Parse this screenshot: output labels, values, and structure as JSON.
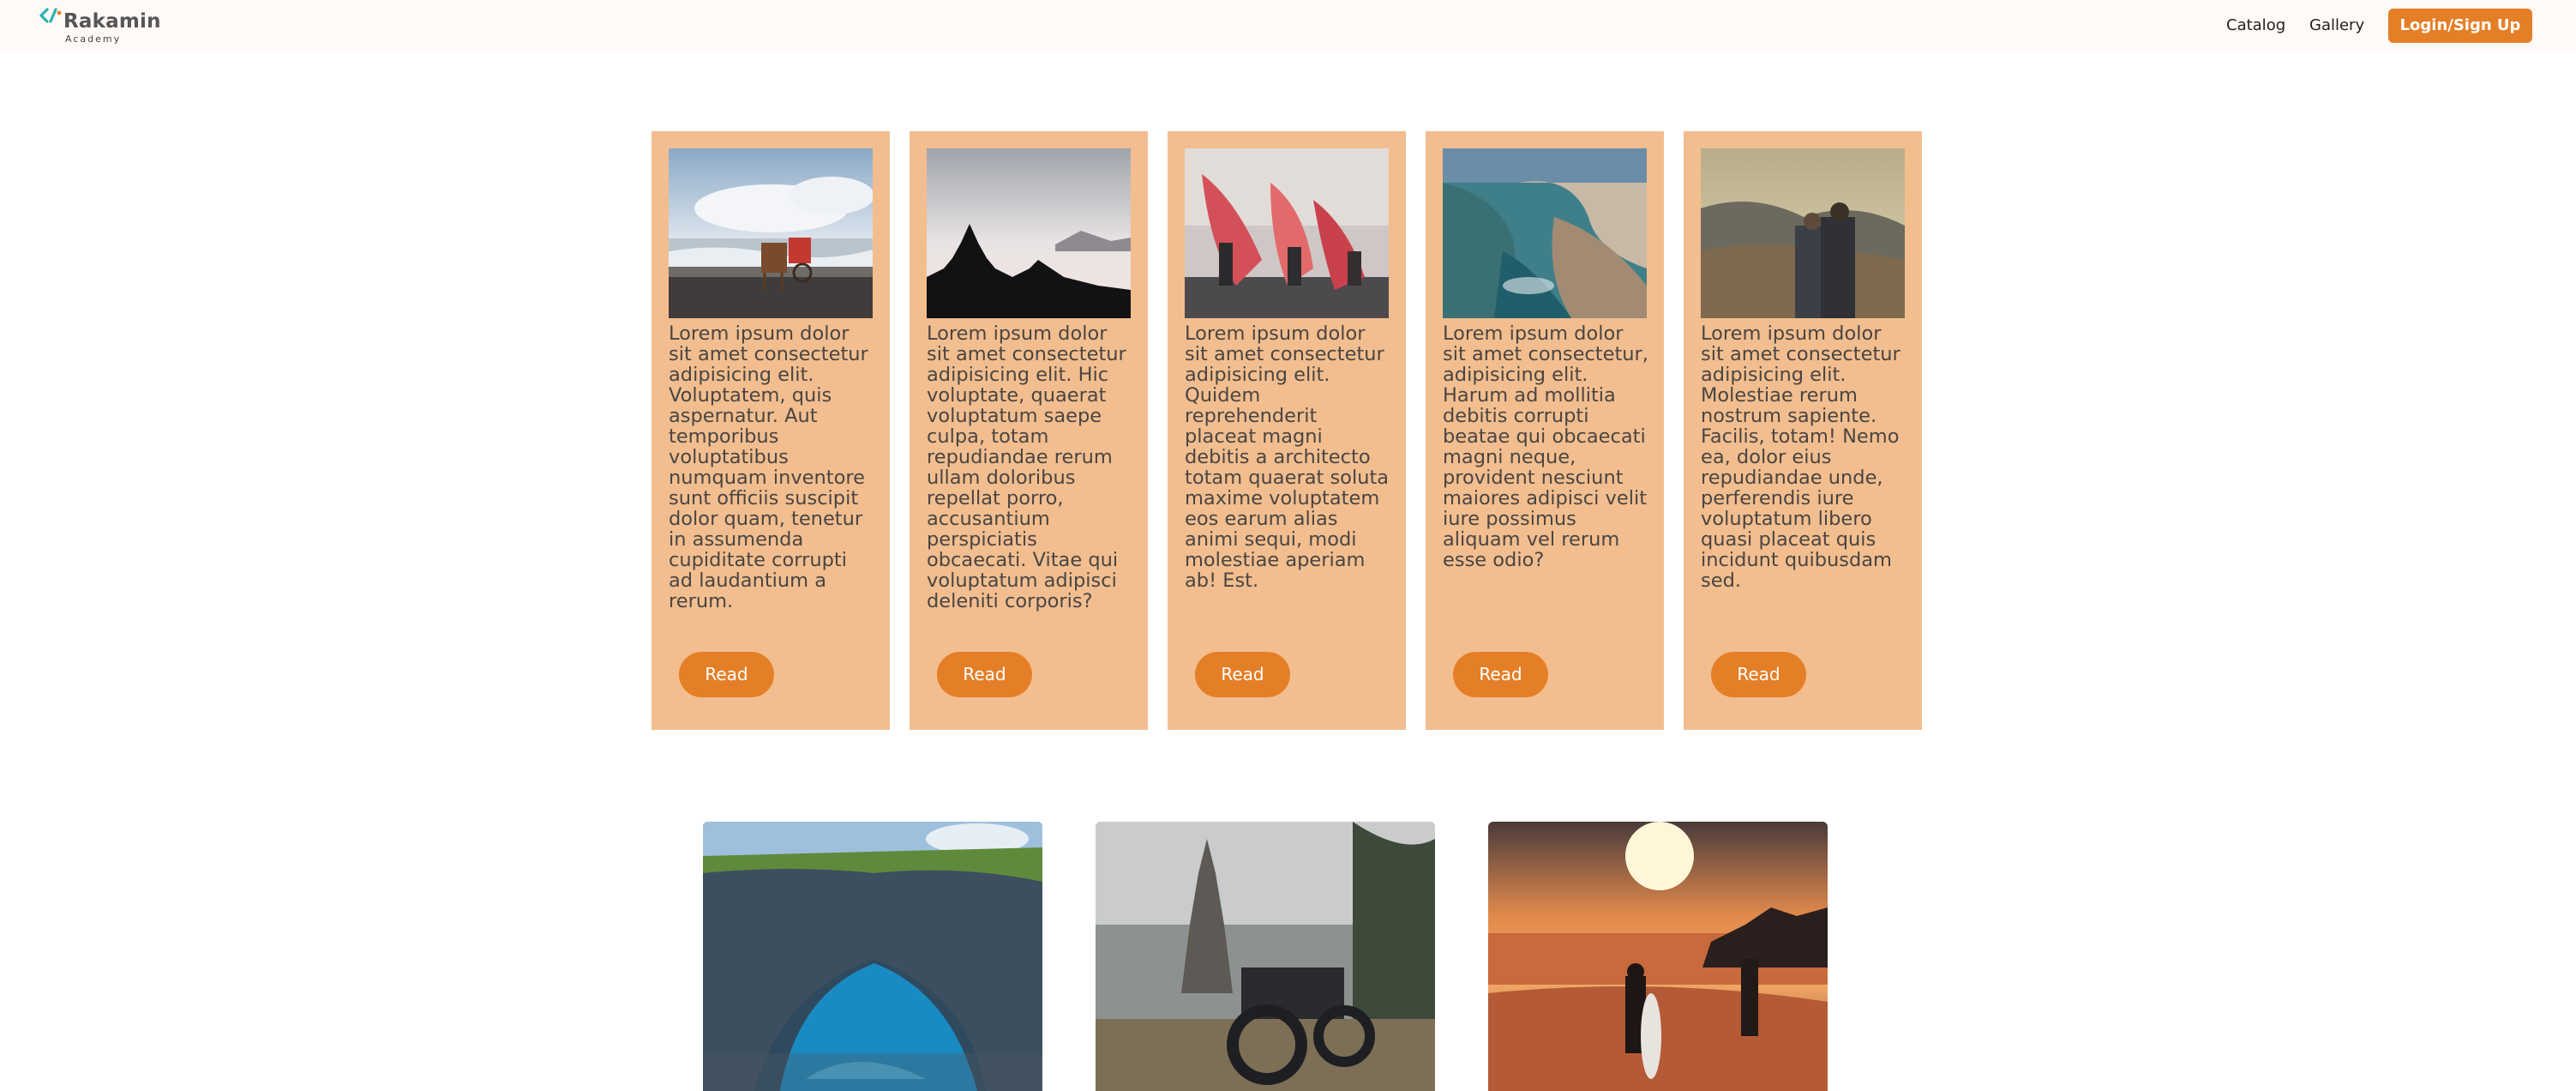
{
  "header": {
    "logo_title": "Rakamin",
    "logo_subtitle": "Academy",
    "nav": {
      "catalog": "Catalog",
      "gallery": "Gallery"
    },
    "login_label": "Login/Sign Up"
  },
  "colors": {
    "accent": "#e57f27",
    "card_bg": "#f2be8f",
    "header_bg": "#fff9f7",
    "logo_teal": "#2bb3b0"
  },
  "cards": [
    {
      "image": "beach-horse-cart-photo",
      "text": "Lorem ipsum dolor sit amet consectetur adipisicing elit. Voluptatem, quis aspernatur. Aut temporibus voluptatibus numquam inventore sunt officiis suscipit dolor quam, tenetur in assumenda cupiditate corrupti ad laudantium a rerum.",
      "button": "Read"
    },
    {
      "image": "temple-silhouette-photo",
      "text": "Lorem ipsum dolor sit amet consectetur adipisicing elit. Hic voluptate, quaerat voluptatum saepe culpa, totam repudiandae rerum ullam doloribus repellat porro, accusantium perspiciatis obcaecati. Vitae qui voluptatum adipisci deleniti corporis?",
      "button": "Read"
    },
    {
      "image": "street-parade-photo",
      "text": "Lorem ipsum dolor sit amet consectetur adipisicing elit. Quidem reprehenderit placeat magni debitis a architecto totam quaerat soluta maxime voluptatem eos earum alias animi sequi, modi molestiae aperiam ab! Est.",
      "button": "Read"
    },
    {
      "image": "coastal-cliff-photo",
      "text": "Lorem ipsum dolor sit amet consectetur, adipisicing elit. Harum ad mollitia debitis corrupti beatae qui obcaecati magni neque, provident nesciunt maiores adipisci velit iure possimus aliquam vel rerum esse odio?",
      "button": "Read"
    },
    {
      "image": "mountain-couple-photo",
      "text": "Lorem ipsum dolor sit amet consectetur adipisicing elit. Molestiae rerum nostrum sapiente. Facilis, totam! Nemo ea, dolor eius repudiandae unde, perferendis iure voluptatum libero quasi placeat quis incidunt quibusdam sed.",
      "button": "Read"
    }
  ],
  "gallery": [
    {
      "image": "sea-arch-photo"
    },
    {
      "image": "motorcycle-temple-photo"
    },
    {
      "image": "sunset-surfers-photo"
    }
  ]
}
